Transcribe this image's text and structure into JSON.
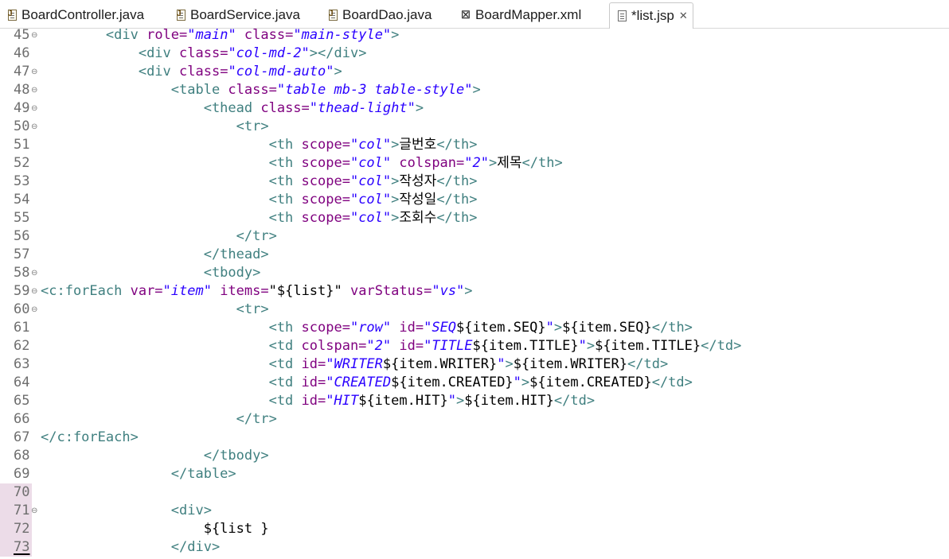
{
  "tabs": [
    {
      "label": "BoardController.java",
      "icon": "java-file-icon"
    },
    {
      "label": "BoardService.java",
      "icon": "java-file-icon"
    },
    {
      "label": "BoardDao.java",
      "icon": "java-file-icon"
    },
    {
      "label": "BoardMapper.xml",
      "icon": "xml-file-icon"
    },
    {
      "label": "*list.jsp",
      "icon": "jsp-file-icon",
      "active": true,
      "close": "✕"
    }
  ],
  "lines": [
    {
      "num": "45",
      "fold": "⊖",
      "indent": "        ",
      "segs": [
        [
          "tag",
          "<div "
        ],
        [
          "attr",
          "role="
        ],
        [
          "str",
          "\"main\""
        ],
        [
          "attr",
          " class="
        ],
        [
          "str",
          "\"main-style\""
        ],
        [
          "tag",
          ">"
        ]
      ]
    },
    {
      "num": "46",
      "fold": "",
      "indent": "            ",
      "segs": [
        [
          "tag",
          "<div "
        ],
        [
          "attr",
          "class="
        ],
        [
          "str",
          "\"col-md-2\""
        ],
        [
          "tag",
          "></div>"
        ]
      ]
    },
    {
      "num": "47",
      "fold": "⊖",
      "indent": "            ",
      "segs": [
        [
          "tag",
          "<div "
        ],
        [
          "attr",
          "class="
        ],
        [
          "str",
          "\"col-md-auto\""
        ],
        [
          "tag",
          ">"
        ]
      ]
    },
    {
      "num": "48",
      "fold": "⊖",
      "indent": "                ",
      "segs": [
        [
          "tag",
          "<table "
        ],
        [
          "attr",
          "class="
        ],
        [
          "str",
          "\"table mb-3 table-style\""
        ],
        [
          "tag",
          ">"
        ]
      ]
    },
    {
      "num": "49",
      "fold": "⊖",
      "indent": "                    ",
      "segs": [
        [
          "tag",
          "<thead "
        ],
        [
          "attr",
          "class="
        ],
        [
          "str",
          "\"thead-light\""
        ],
        [
          "tag",
          ">"
        ]
      ]
    },
    {
      "num": "50",
      "fold": "⊖",
      "indent": "                        ",
      "segs": [
        [
          "tag",
          "<tr>"
        ]
      ]
    },
    {
      "num": "51",
      "fold": "",
      "indent": "                            ",
      "segs": [
        [
          "tag",
          "<th "
        ],
        [
          "attr",
          "scope="
        ],
        [
          "str",
          "\"col\""
        ],
        [
          "tag",
          ">"
        ],
        [
          "text",
          "글번호"
        ],
        [
          "tag",
          "</th>"
        ]
      ]
    },
    {
      "num": "52",
      "fold": "",
      "indent": "                            ",
      "segs": [
        [
          "tag",
          "<th "
        ],
        [
          "attr",
          "scope="
        ],
        [
          "str",
          "\"col\""
        ],
        [
          "attr",
          " colspan="
        ],
        [
          "str",
          "\"2\""
        ],
        [
          "tag",
          ">"
        ],
        [
          "text",
          "제목"
        ],
        [
          "tag",
          "</th>"
        ]
      ]
    },
    {
      "num": "53",
      "fold": "",
      "indent": "                            ",
      "segs": [
        [
          "tag",
          "<th "
        ],
        [
          "attr",
          "scope="
        ],
        [
          "str",
          "\"col\""
        ],
        [
          "tag",
          ">"
        ],
        [
          "text",
          "작성자"
        ],
        [
          "tag",
          "</th>"
        ]
      ]
    },
    {
      "num": "54",
      "fold": "",
      "indent": "                            ",
      "segs": [
        [
          "tag",
          "<th "
        ],
        [
          "attr",
          "scope="
        ],
        [
          "str",
          "\"col\""
        ],
        [
          "tag",
          ">"
        ],
        [
          "text",
          "작성일"
        ],
        [
          "tag",
          "</th>"
        ]
      ]
    },
    {
      "num": "55",
      "fold": "",
      "indent": "                            ",
      "segs": [
        [
          "tag",
          "<th "
        ],
        [
          "attr",
          "scope="
        ],
        [
          "str",
          "\"col\""
        ],
        [
          "tag",
          ">"
        ],
        [
          "text",
          "조회수"
        ],
        [
          "tag",
          "</th>"
        ]
      ]
    },
    {
      "num": "56",
      "fold": "",
      "indent": "                        ",
      "segs": [
        [
          "tag",
          "</tr>"
        ]
      ]
    },
    {
      "num": "57",
      "fold": "",
      "indent": "                    ",
      "segs": [
        [
          "tag",
          "</thead>"
        ]
      ]
    },
    {
      "num": "58",
      "fold": "⊖",
      "indent": "                    ",
      "segs": [
        [
          "tag",
          "<tbody>"
        ]
      ]
    },
    {
      "num": "59",
      "fold": "⊖",
      "indent": "",
      "segs": [
        [
          "tag",
          "<c:forEach "
        ],
        [
          "attr",
          "var="
        ],
        [
          "str",
          "\"item\""
        ],
        [
          "attr",
          " items="
        ],
        [
          "text",
          "\"${list}\""
        ],
        [
          "attr",
          " varStatus="
        ],
        [
          "str",
          "\"vs\""
        ],
        [
          "tag",
          ">"
        ]
      ]
    },
    {
      "num": "60",
      "fold": "⊖",
      "indent": "                        ",
      "segs": [
        [
          "tag",
          "<tr>"
        ]
      ]
    },
    {
      "num": "61",
      "fold": "",
      "indent": "                            ",
      "segs": [
        [
          "tag",
          "<th "
        ],
        [
          "attr",
          "scope="
        ],
        [
          "str",
          "\"row\""
        ],
        [
          "attr",
          " id="
        ],
        [
          "str",
          "\"SEQ"
        ],
        [
          "text",
          "${item.SEQ}"
        ],
        [
          "str",
          "\""
        ],
        [
          "tag",
          ">"
        ],
        [
          "text",
          "${item.SEQ}"
        ],
        [
          "tag",
          "</th>"
        ]
      ]
    },
    {
      "num": "62",
      "fold": "",
      "indent": "                            ",
      "segs": [
        [
          "tag",
          "<td "
        ],
        [
          "attr",
          "colspan="
        ],
        [
          "str",
          "\"2\""
        ],
        [
          "attr",
          " id="
        ],
        [
          "str",
          "\"TITLE"
        ],
        [
          "text",
          "${item.TITLE}"
        ],
        [
          "str",
          "\""
        ],
        [
          "tag",
          ">"
        ],
        [
          "text",
          "${item.TITLE}"
        ],
        [
          "tag",
          "</td>"
        ]
      ]
    },
    {
      "num": "63",
      "fold": "",
      "indent": "                            ",
      "segs": [
        [
          "tag",
          "<td "
        ],
        [
          "attr",
          "id="
        ],
        [
          "str",
          "\"WRITER"
        ],
        [
          "text",
          "${item.WRITER}"
        ],
        [
          "str",
          "\""
        ],
        [
          "tag",
          ">"
        ],
        [
          "text",
          "${item.WRITER}"
        ],
        [
          "tag",
          "</td>"
        ]
      ]
    },
    {
      "num": "64",
      "fold": "",
      "indent": "                            ",
      "segs": [
        [
          "tag",
          "<td "
        ],
        [
          "attr",
          "id="
        ],
        [
          "str",
          "\"CREATED"
        ],
        [
          "text",
          "${item.CREATED}"
        ],
        [
          "str",
          "\""
        ],
        [
          "tag",
          ">"
        ],
        [
          "text",
          "${item.CREATED}"
        ],
        [
          "tag",
          "</td>"
        ]
      ]
    },
    {
      "num": "65",
      "fold": "",
      "indent": "                            ",
      "segs": [
        [
          "tag",
          "<td "
        ],
        [
          "attr",
          "id="
        ],
        [
          "str",
          "\"HIT"
        ],
        [
          "text",
          "${item.HIT}"
        ],
        [
          "str",
          "\""
        ],
        [
          "tag",
          ">"
        ],
        [
          "text",
          "${item.HIT}"
        ],
        [
          "tag",
          "</td>"
        ]
      ]
    },
    {
      "num": "66",
      "fold": "",
      "indent": "                        ",
      "segs": [
        [
          "tag",
          "</tr>"
        ]
      ]
    },
    {
      "num": "67",
      "fold": "",
      "indent": "",
      "segs": [
        [
          "tag",
          "</c:forEach>"
        ]
      ]
    },
    {
      "num": "68",
      "fold": "",
      "indent": "                    ",
      "segs": [
        [
          "tag",
          "</tbody>"
        ]
      ]
    },
    {
      "num": "69",
      "fold": "",
      "indent": "                ",
      "segs": [
        [
          "tag",
          "</table>"
        ]
      ]
    },
    {
      "num": "70",
      "fold": "",
      "indent": "",
      "mod": true,
      "segs": []
    },
    {
      "num": "71",
      "fold": "⊖",
      "indent": "                ",
      "mod": true,
      "segs": [
        [
          "tag",
          "<div>"
        ]
      ]
    },
    {
      "num": "72",
      "fold": "",
      "indent": "                    ",
      "mod": true,
      "segs": [
        [
          "text",
          "${list }"
        ]
      ]
    },
    {
      "num": "73",
      "fold": "",
      "indent": "                ",
      "mod": true,
      "current": true,
      "segs": [
        [
          "tag",
          "</div>"
        ]
      ]
    }
  ],
  "colors": {
    "tag": "#3f7f7f",
    "attr": "#7f007f",
    "str": "#2a00ff",
    "text": "#000000",
    "modified_gutter": "#ecdce8"
  }
}
